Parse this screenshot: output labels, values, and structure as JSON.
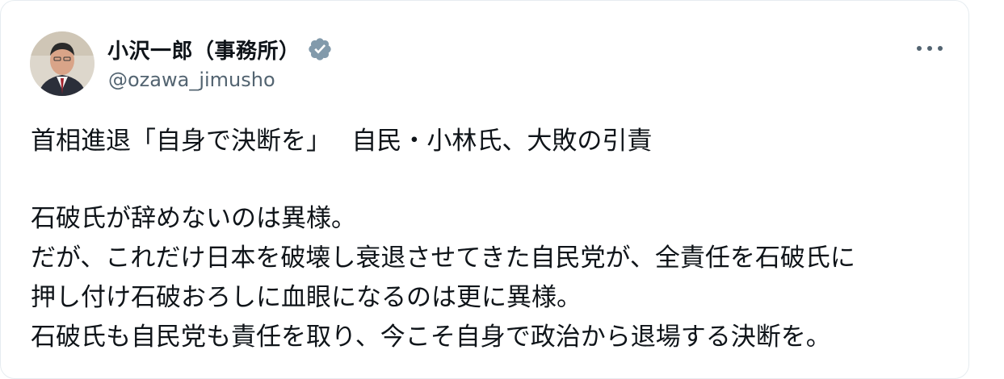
{
  "tweet": {
    "author": {
      "display_name": "小沢一郎（事務所）",
      "handle": "@ozawa_jimusho",
      "verified_badge_icon": "verified-badge-icon",
      "avatar": "profile-photo"
    },
    "more_icon": "more-horizontal-icon",
    "body": {
      "headline": "首相進退「自身で決断を」　 自民・小林氏、大敗の引責",
      "lines": [
        "石破氏が辞めないのは異様。",
        "だが、これだけ日本を破壊し衰退させてきた自民党が、全責任を石破氏に",
        "押し付け石破おろしに血眼になるのは更に異様。",
        "石破氏も自民党も責任を取り、今こそ自身で政治から退場する決断を。"
      ]
    },
    "colors": {
      "text": "#0f1419",
      "secondary": "#536471",
      "verified_badge": "#829aab"
    }
  }
}
